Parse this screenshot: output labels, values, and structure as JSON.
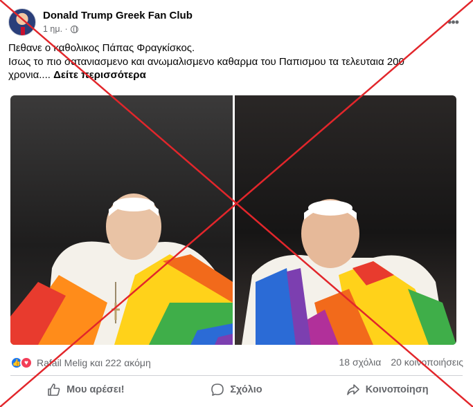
{
  "post": {
    "page_name": "Donald Trump Greek Fan Club",
    "time": "1 ημ. ·",
    "text_line1": "Πεθανε ο καθολικος Πάπας Φραγκίσκος.",
    "text_line2": "Ισως το πιο σατανιασμενο και ανωμαλισμενο καθαρμα του Παπισμου τα τελευταια 200",
    "text_line3": "χρονια....",
    "see_more": "Δείτε περισσότερα"
  },
  "reactions": {
    "summary": "Rafail Melig και 222 ακόμη",
    "comments": "18 σχόλια",
    "shares": "20 κοινοποιήσεις"
  },
  "actions": {
    "like": "Μου αρέσει!",
    "comment": "Σχόλιο",
    "share": "Κοινοποίηση"
  },
  "colors": {
    "cross": "#e2262b",
    "facebook_blue": "#1877f2",
    "love_red": "#f33e58"
  },
  "icons": [
    "globe-icon",
    "more-icon",
    "like-icon",
    "comment-icon",
    "share-icon"
  ]
}
